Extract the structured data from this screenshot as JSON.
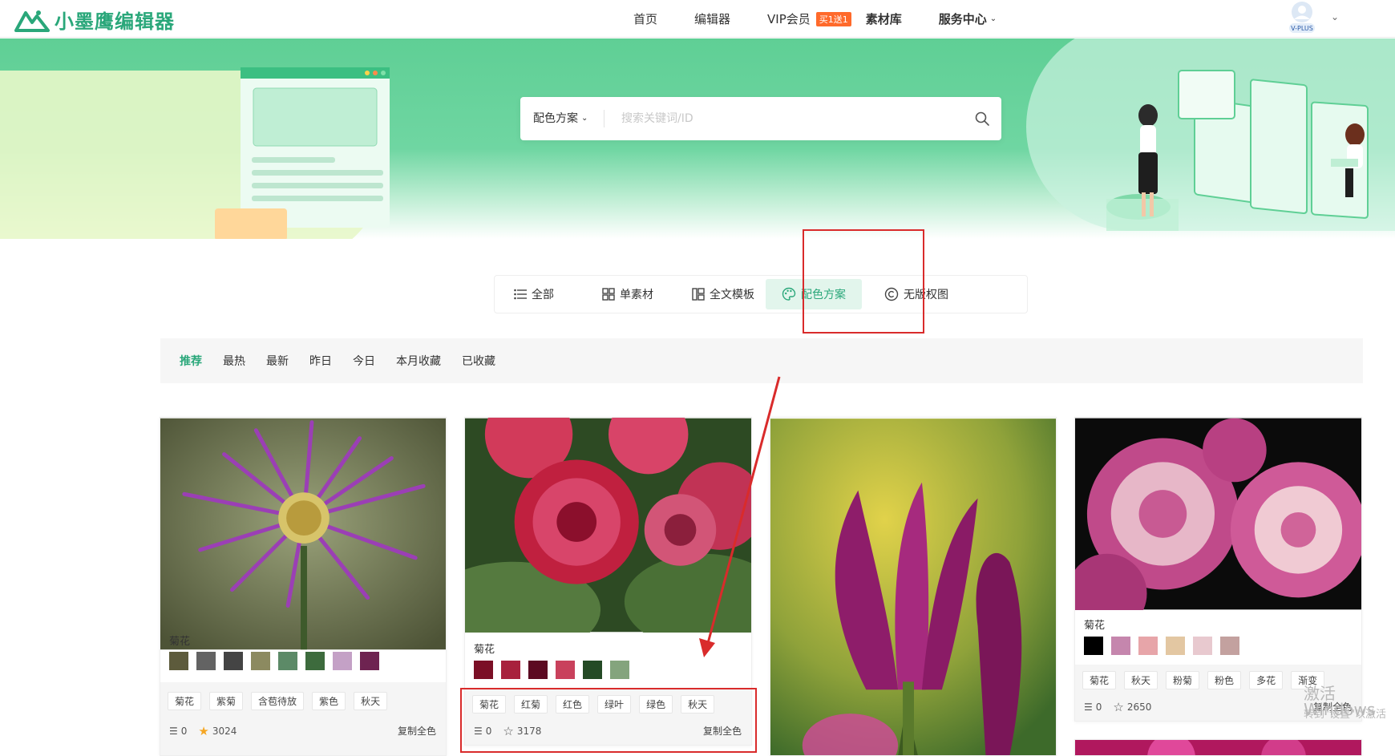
{
  "app": {
    "logo_text": "小墨鹰编辑器"
  },
  "nav": {
    "home": "首页",
    "editor": "编辑器",
    "vip": "VIP会员",
    "vip_badge": "买1送1",
    "materials": "素材库",
    "service": "服务中心",
    "avatar_badge": "V-PLUS"
  },
  "search": {
    "type_label": "配色方案",
    "placeholder": "搜索关键词/ID"
  },
  "category_tabs": [
    {
      "label": "全部",
      "icon": "list-icon"
    },
    {
      "label": "单素材",
      "icon": "grid-icon"
    },
    {
      "label": "全文模板",
      "icon": "template-icon"
    },
    {
      "label": "配色方案",
      "icon": "palette-icon",
      "active": true
    },
    {
      "label": "无版权图",
      "icon": "copyright-icon"
    }
  ],
  "filters": [
    "推荐",
    "最热",
    "最新",
    "昨日",
    "今日",
    "本月收藏",
    "已收藏"
  ],
  "cards": [
    {
      "title": "菊花",
      "colors": [
        "#5d5b3c",
        "#636363",
        "#444444",
        "#8c8a60",
        "#5c8a67",
        "#3d6b3d",
        "#c4a1c6",
        "#6e2351"
      ],
      "tags": [
        "菊花",
        "紫菊",
        "含苞待放",
        "紫色",
        "秋天"
      ],
      "layers": "0",
      "favorites": "3024",
      "copy_label": "复制全色"
    },
    {
      "title": "菊花",
      "colors": [
        "#7b0f26",
        "#a8213d",
        "#5c0a22",
        "#c9415c",
        "#244a25",
        "#84a47d"
      ],
      "tags": [
        "菊花",
        "红菊",
        "红色",
        "绿叶",
        "绿色",
        "秋天"
      ],
      "layers": "0",
      "favorites": "3178",
      "copy_label": "复制全色"
    },
    {
      "title": "",
      "colors": [],
      "tags": [],
      "layers": "",
      "favorites": "",
      "copy_label": ""
    },
    {
      "title": "菊花",
      "colors": [
        "#000000",
        "#c586ad",
        "#e7a5a9",
        "#e3c7a2",
        "#e8c9cf",
        "#c3a19f"
      ],
      "tags": [
        "菊花",
        "秋天",
        "粉菊",
        "粉色",
        "多花",
        "渐变"
      ],
      "layers": "0",
      "favorites": "2650",
      "copy_label": "复制全色"
    }
  ],
  "watermark": {
    "line1": "激活 Windows",
    "line2": "转到\"设置\"以激活"
  }
}
